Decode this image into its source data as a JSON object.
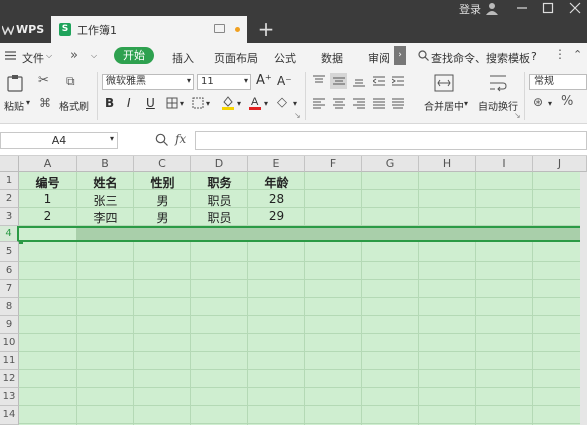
{
  "titlebar": {
    "app_label": "WPS",
    "doc_tab_label": "工作簿1",
    "doc_icon": "S",
    "new_tab": "+",
    "login_label": "登录",
    "icons": [
      "user-icon",
      "minimize-icon",
      "maximize-icon",
      "close-icon"
    ]
  },
  "menu": {
    "file_label": "文件",
    "tabs": [
      "开始",
      "插入",
      "页面布局",
      "公式",
      "数据",
      "审阅"
    ],
    "active_tab": "开始",
    "search_label": "查找命令、搜索模板",
    "help": "?",
    "more": "»"
  },
  "ribbon": {
    "paste_label": "粘贴",
    "format_painter_label": "格式刷",
    "font_name": "微软雅黑",
    "font_size": "11",
    "grow_font": "A⁺",
    "shrink_font": "A⁻",
    "bold": "B",
    "italic": "I",
    "underline": "U",
    "merge_label": "合并居中",
    "wrap_label": "自动换行",
    "number_format": "常规",
    "percent": "%",
    "font_color_accent": "#e02020",
    "fill_color_accent": "#f5d400"
  },
  "formula_bar": {
    "cell_ref": "A4",
    "fx_label": "fx",
    "formula": ""
  },
  "sheet": {
    "columns": [
      "A",
      "B",
      "C",
      "D",
      "E",
      "F",
      "G",
      "H",
      "I",
      "J"
    ],
    "rows": [
      "1",
      "2",
      "3",
      "4",
      "5",
      "6",
      "7",
      "8",
      "9",
      "10",
      "11",
      "12",
      "13",
      "14"
    ],
    "selected_row": "4",
    "header": [
      "编号",
      "姓名",
      "性别",
      "职务",
      "年龄"
    ],
    "data": [
      [
        "1",
        "张三",
        "男",
        "职员",
        "28"
      ],
      [
        "2",
        "李四",
        "男",
        "职员",
        "29"
      ]
    ],
    "grid_color": "#cfeed0",
    "selection_color": "#2b9a45"
  }
}
